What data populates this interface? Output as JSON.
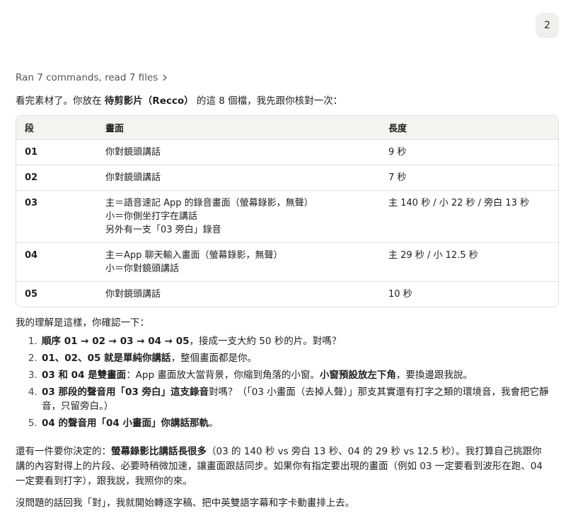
{
  "user_message": {
    "text": "2"
  },
  "tool_summary": {
    "label": "Ran 7 commands, read 7 files",
    "icon": "chevron-right-icon"
  },
  "intro": {
    "pre": "看完素材了。你放在 ",
    "folder": "待剪影片（Recco）",
    "post": " 的這 8 個檔，我先跟你核對一次："
  },
  "table": {
    "headers": [
      "段",
      "畫面",
      "長度"
    ],
    "rows": [
      {
        "seg": "01",
        "scene": [
          "你對鏡頭講話"
        ],
        "length": "9 秒"
      },
      {
        "seg": "02",
        "scene": [
          "你對鏡頭講話"
        ],
        "length": "7 秒"
      },
      {
        "seg": "03",
        "scene": [
          "主＝語音速記 App 的錄音畫面（螢幕錄影，無聲）",
          "小＝你側坐打字在講話",
          "另外有一支「03 旁白」錄音"
        ],
        "length": "主 140 秒 / 小 22 秒 / 旁白 13 秒"
      },
      {
        "seg": "04",
        "scene": [
          "主＝App 聊天輸入畫面（螢幕錄影，無聲）",
          "小＝你對鏡頭講話"
        ],
        "length": "主 29 秒 / 小 12.5 秒"
      },
      {
        "seg": "05",
        "scene": [
          "你對鏡頭講話"
        ],
        "length": "10 秒"
      }
    ]
  },
  "understanding": {
    "intro": "我的理解是這樣，你確認一下：",
    "items": [
      {
        "parts": [
          {
            "t": "順序 01 → 02 → 03 → 04 → 05",
            "b": true
          },
          {
            "t": "，接成一支大約 50 秒的片。對嗎？",
            "b": false
          }
        ]
      },
      {
        "parts": [
          {
            "t": "01、02、05 就是單純你講話",
            "b": true
          },
          {
            "t": "，整個畫面都是你。",
            "b": false
          }
        ]
      },
      {
        "parts": [
          {
            "t": "03 和 04 是雙畫面",
            "b": true
          },
          {
            "t": "：App 畫面放大當背景，你縮到角落的小窗。",
            "b": false
          },
          {
            "t": "小窗預設放左下角",
            "b": true
          },
          {
            "t": "，要換邊跟我說。",
            "b": false
          }
        ]
      },
      {
        "parts": [
          {
            "t": "03 那段的聲音用「03 旁白」這支錄音",
            "b": true
          },
          {
            "t": "對嗎？（「03 小畫面（去掉人聲）」那支其實還有打字之類的環境音，我會把它靜音，只留旁白。）",
            "b": false
          }
        ]
      },
      {
        "parts": [
          {
            "t": "04 的聲音用「04 小畫面」你講話那軌",
            "b": true
          },
          {
            "t": "。",
            "b": false
          }
        ]
      }
    ]
  },
  "decision": {
    "parts": [
      {
        "t": "還有一件要你決定的：",
        "b": false
      },
      {
        "t": "螢幕錄影比講話長很多",
        "b": true
      },
      {
        "t": "（03 的 140 秒 vs 旁白 13 秒、04 的 29 秒 vs 12.5 秒）。我打算自己挑跟你講的內容對得上的片段、必要時稍微加速，讓畫面跟話同步。如果你有指定要出現的畫面（例如 03 一定要看到波形在跑、04 一定要看到打字），跟我說，我照你的來。",
        "b": false
      }
    ]
  },
  "closing": {
    "text": "沒問題的話回我「對」，我就開始轉逐字稿、把中英雙語字幕和字卡動畫排上去。"
  }
}
